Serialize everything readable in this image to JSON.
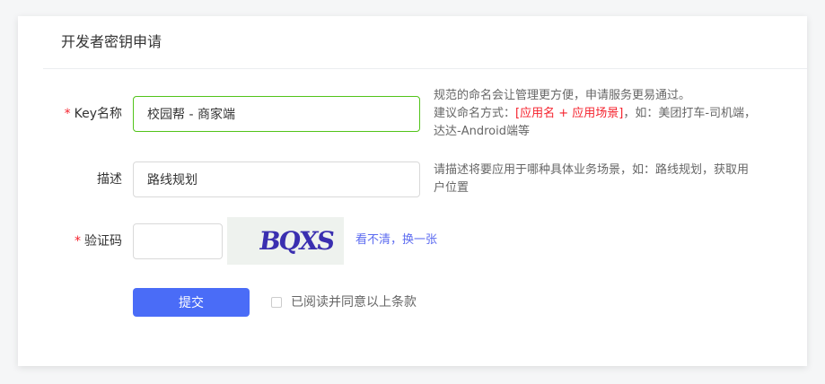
{
  "card": {
    "title": "开发者密钥申请"
  },
  "form": {
    "key_name": {
      "required_mark": "*",
      "label": "Key名称",
      "value": "校园帮 - 商家端",
      "hint_line1": "规范的命名会让管理更方便，申请服务更易通过。",
      "hint_prefix": "建议命名方式：",
      "hint_pattern": "[应用名 + 应用场景]",
      "hint_suffix": "，如：美团打车-司机端，达达-Android端等"
    },
    "description": {
      "label": "描述",
      "value": "路线规划",
      "hint": "请描述将要应用于哪种具体业务场景，如：路线规划，获取用户位置"
    },
    "captcha": {
      "required_mark": "*",
      "label": "验证码",
      "value": "",
      "image_text": "BQXS",
      "refresh_label": "看不清，换一张"
    },
    "submit_label": "提交",
    "agree_label": "已阅读并同意以上条款"
  },
  "colors": {
    "primary": "#4a6cf7",
    "required": "#f5222d",
    "focus_border": "#52c41a",
    "link": "#5c6bf0"
  }
}
